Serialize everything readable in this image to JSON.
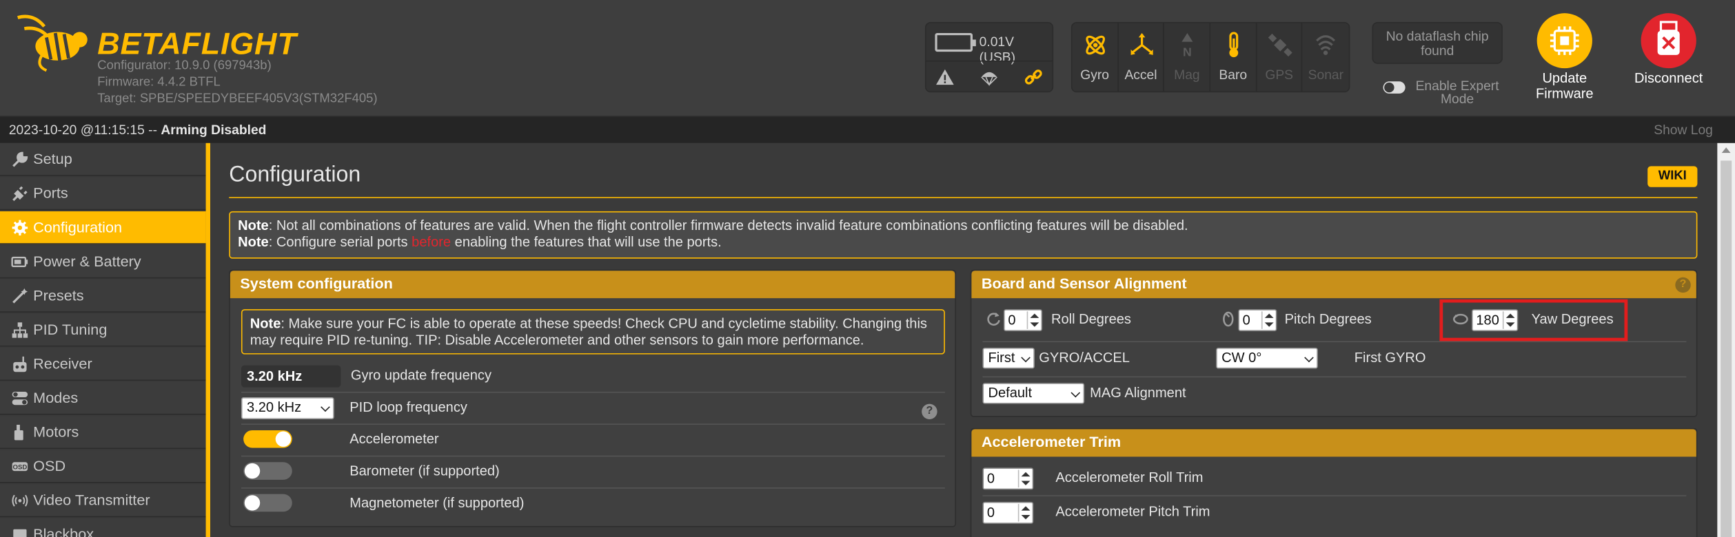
{
  "header": {
    "brand": "BETAFLIGHT",
    "configurator": "Configurator: 10.9.0 (697943b)",
    "firmware": "Firmware: 4.4.2 BTFL",
    "target": "Target: SPBE/SPEEDYBEEF405V3(STM32F405)",
    "battery": "0.01V (USB)",
    "sensors": [
      {
        "label": "Gyro",
        "icon": "gyro-icon",
        "active": true
      },
      {
        "label": "Accel",
        "icon": "accel-icon",
        "active": true
      },
      {
        "label": "Mag",
        "icon": "mag-icon",
        "active": false
      },
      {
        "label": "Baro",
        "icon": "baro-icon",
        "active": true
      },
      {
        "label": "GPS",
        "icon": "gps-icon",
        "active": false
      },
      {
        "label": "Sonar",
        "icon": "sonar-icon",
        "active": false
      }
    ],
    "dataflash": "No dataflash chip found",
    "expert_mode": "Enable Expert Mode",
    "update_firmware": "Update Firmware",
    "disconnect": "Disconnect"
  },
  "status": {
    "datetime": "2023-10-20 @11:15:15 --",
    "arming": "Arming Disabled",
    "show_log": "Show Log"
  },
  "sidebar": {
    "items": [
      {
        "label": "Setup",
        "icon": "wrench-icon"
      },
      {
        "label": "Ports",
        "icon": "plug-icon"
      },
      {
        "label": "Configuration",
        "icon": "gear-icon",
        "active": true
      },
      {
        "label": "Power & Battery",
        "icon": "battery-icon"
      },
      {
        "label": "Presets",
        "icon": "wand-icon"
      },
      {
        "label": "PID Tuning",
        "icon": "sitemap-icon"
      },
      {
        "label": "Receiver",
        "icon": "radio-icon"
      },
      {
        "label": "Modes",
        "icon": "toggles-icon"
      },
      {
        "label": "Motors",
        "icon": "motor-icon"
      },
      {
        "label": "OSD",
        "icon": "osd-icon"
      },
      {
        "label": "Video Transmitter",
        "icon": "broadcast-icon"
      },
      {
        "label": "Blackbox",
        "icon": "blackbox-icon"
      }
    ]
  },
  "page": {
    "title": "Configuration",
    "wiki": "WIKI",
    "note1_bold": "Note",
    "note1": ": Not all combinations of features are valid. When the flight controller firmware detects invalid feature combinations conflicting features will be disabled.",
    "note2_bold": "Note",
    "note2_a": ": Configure serial ports ",
    "note2_red": "before",
    "note2_b": " enabling the features that will use the ports."
  },
  "system_config": {
    "title": "System configuration",
    "note_bold": "Note",
    "note": ": Make sure your FC is able to operate at these speeds! Check CPU and cycletime stability. Changing this may require PID re-tuning. TIP: Disable Accelerometer and other sensors to gain more performance.",
    "gyro_freq_value": "3.20 kHz",
    "gyro_freq_label": "Gyro update frequency",
    "pid_freq_value": "3.20 kHz",
    "pid_freq_label": "PID loop frequency",
    "accelerometer": "Accelerometer",
    "barometer": "Barometer (if supported)",
    "magnetometer": "Magnetometer (if supported)"
  },
  "board_alignment": {
    "title": "Board and Sensor Alignment",
    "roll_value": "0",
    "roll_label": "Roll Degrees",
    "pitch_value": "0",
    "pitch_label": "Pitch Degrees",
    "yaw_value": "180",
    "yaw_label": "Yaw Degrees",
    "gyro_select": "First",
    "gyro_accel_label": "GYRO/ACCEL",
    "align_select": "CW 0°",
    "first_gyro_label": "First GYRO",
    "mag_select": "Default",
    "mag_label": "MAG Alignment"
  },
  "accel_trim": {
    "title": "Accelerometer Trim",
    "roll_value": "0",
    "roll_label": "Accelerometer Roll Trim",
    "pitch_value": "0",
    "pitch_label": "Accelerometer Pitch Trim"
  },
  "colors": {
    "accent": "#ffbb00",
    "panel_header": "#c8901a",
    "highlight": "#e21d1d",
    "disconnect": "#e2252d"
  }
}
